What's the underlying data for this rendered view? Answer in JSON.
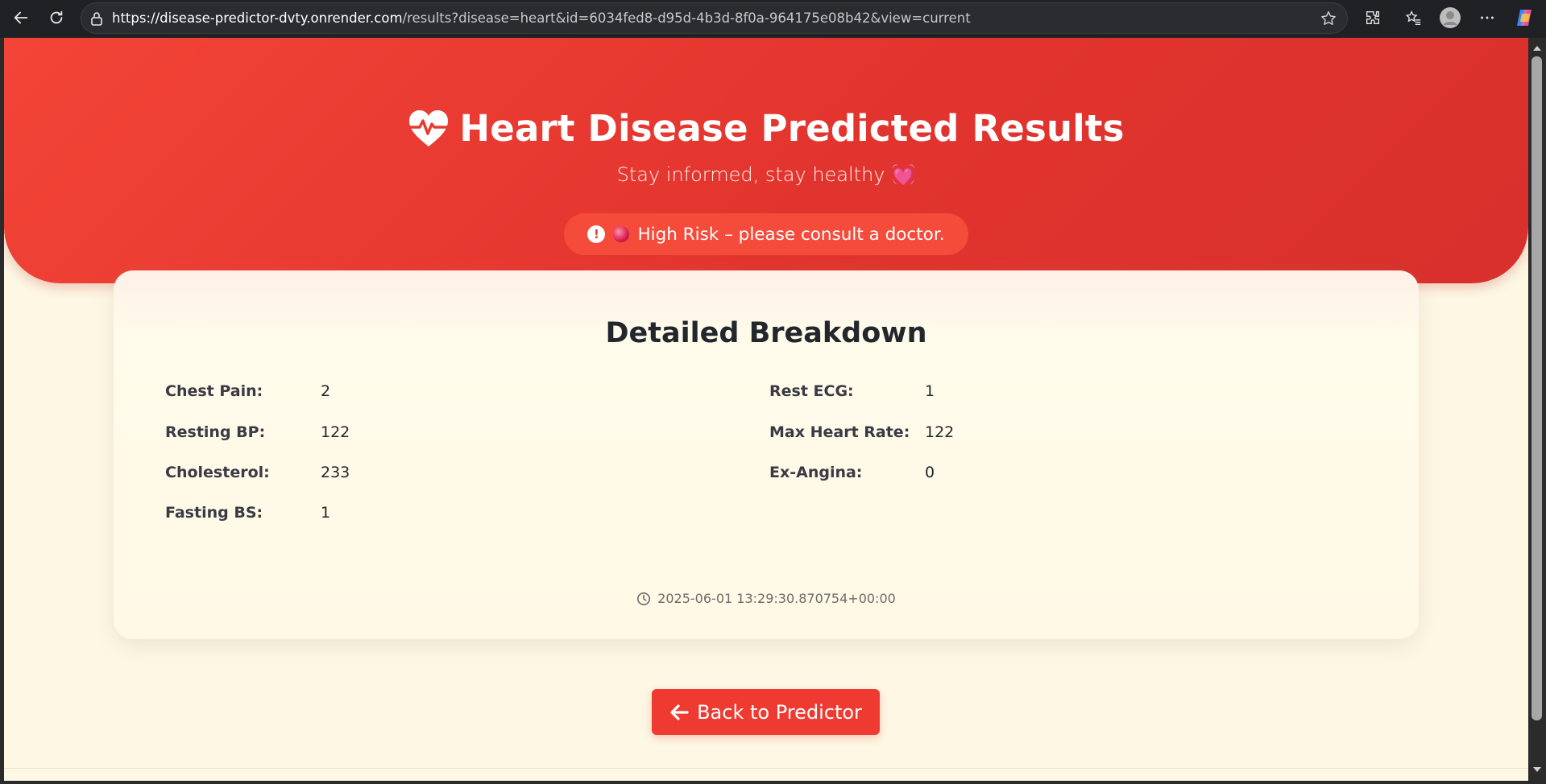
{
  "browser": {
    "url_host": "https://disease-predictor-dvty.onrender.com",
    "url_path": "/results?disease=heart&id=6034fed8-d95d-4b3d-8f0a-964175e08b42&view=current",
    "icons": [
      "back-arrow-icon",
      "reload-icon",
      "lock-icon",
      "star-icon",
      "extensions-icon",
      "favorites-icon",
      "profile-icon",
      "more-icon",
      "copilot-icon"
    ]
  },
  "hero": {
    "title": "Heart Disease Predicted Results",
    "subtitle": "Stay informed, stay healthy",
    "subtitle_emoji": "💓",
    "risk_text": "High Risk – please consult a doctor.",
    "colors": {
      "hero_start": "#f34437",
      "hero_end": "#d8302d",
      "pill": "#f44b3a"
    }
  },
  "breakdown": {
    "title": "Detailed Breakdown",
    "left": [
      {
        "label": "Chest Pain:",
        "value": "2"
      },
      {
        "label": "Resting BP:",
        "value": "122"
      },
      {
        "label": "Cholesterol:",
        "value": "233"
      },
      {
        "label": "Fasting BS:",
        "value": "1"
      }
    ],
    "right": [
      {
        "label": "Rest ECG:",
        "value": "1"
      },
      {
        "label": "Max Heart Rate:",
        "value": "122"
      },
      {
        "label": "Ex-Angina:",
        "value": "0"
      }
    ],
    "timestamp": "2025-06-01 13:29:30.870754+00:00"
  },
  "actions": {
    "back_label": "Back to Predictor",
    "button_color": "#ef3a31"
  },
  "page": {
    "background": "#fdf7e4"
  }
}
